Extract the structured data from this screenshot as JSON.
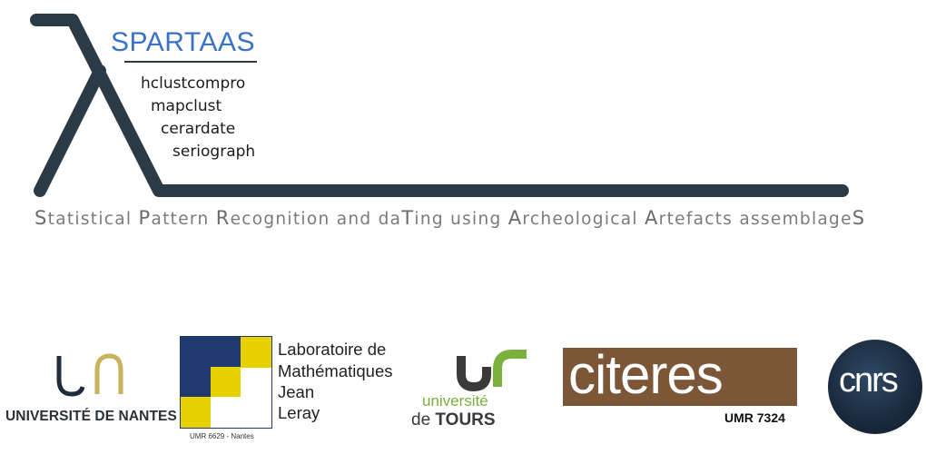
{
  "header": {
    "title": "SPARTAAS",
    "packages": [
      "hclustcompro",
      "mapclust",
      "cerardate",
      "seriograph"
    ],
    "tagline_parts": [
      {
        "text": "S",
        "cap": true
      },
      {
        "text": "tatistical ",
        "cap": false
      },
      {
        "text": "P",
        "cap": true
      },
      {
        "text": "attern ",
        "cap": false
      },
      {
        "text": "R",
        "cap": true
      },
      {
        "text": "ecognition and da",
        "cap": false
      },
      {
        "text": "T",
        "cap": true
      },
      {
        "text": "ing using ",
        "cap": false
      },
      {
        "text": "A",
        "cap": true
      },
      {
        "text": "rcheological ",
        "cap": false
      },
      {
        "text": "A",
        "cap": true
      },
      {
        "text": "rtefacts assemblage",
        "cap": false
      },
      {
        "text": "S",
        "cap": true
      }
    ]
  },
  "partners": {
    "nantes": {
      "name": "UNIVERSITÉ DE NANTES"
    },
    "lmjl": {
      "lines": [
        "Laboratoire de",
        "Mathématiques",
        "Jean",
        "Leray"
      ],
      "caption": "UMR 6629  -  Nantes"
    },
    "tours": {
      "top": "université",
      "bottom_prefix": "de ",
      "bottom_bold": "TOURS"
    },
    "citeres": {
      "word": "citeres",
      "umr": "UMR 7324"
    },
    "cnrs": {
      "name": "cnrs"
    }
  },
  "colors": {
    "lambda": "#2b3a44",
    "title_blue": "#3a72c8",
    "nantes_gold": "#c9b25a",
    "lmjl_blue": "#1f3a6e",
    "lmjl_yellow": "#e8d100",
    "tours_green": "#7ab13c",
    "citeres_brown": "#7b5637",
    "cnrs_blue": "#1b2c40"
  }
}
